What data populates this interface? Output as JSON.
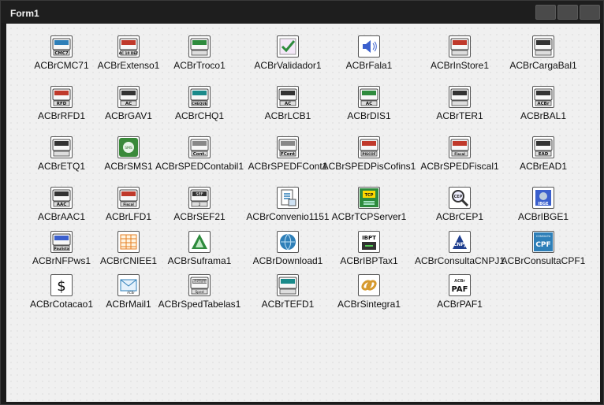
{
  "window": {
    "title": "Form1"
  },
  "titlebar_buttons": [
    "minimize",
    "maximize",
    "close"
  ],
  "components": [
    {
      "label": "ACBrCMC71",
      "icon": "cmc7-check-reader-icon",
      "icon_text": "CMC7",
      "color": "#2e7fb8"
    },
    {
      "label": "ACBrExtenso1",
      "icon": "extenso-number-words-icon",
      "icon_text": "AC 10 DEZ",
      "color": "#c0392b"
    },
    {
      "label": "ACBrTroco1",
      "icon": "troco-change-icon",
      "icon_text": "",
      "color": "#2e8b3d"
    },
    {
      "label": "ACBrValidador1",
      "icon": "validador-check-icon",
      "icon_text": "",
      "color": "#2e8b3d"
    },
    {
      "label": "ACBrFala1",
      "icon": "fala-speaker-icon",
      "icon_text": "",
      "color": "#3a5fcd"
    },
    {
      "label": "ACBrInStore1",
      "icon": "instore-barcode-icon",
      "icon_text": "",
      "color": "#c0392b"
    },
    {
      "label": "ACBrCargaBal1",
      "icon": "carga-bal-scale-load-icon",
      "icon_text": "",
      "color": "#333333"
    },
    {
      "label": "ACBrRFD1",
      "icon": "rfd-printer-icon",
      "icon_text": "RFD",
      "color": "#c0392b"
    },
    {
      "label": "ACBrGAV1",
      "icon": "gav-cash-drawer-icon",
      "icon_text": "AC",
      "color": "#333333"
    },
    {
      "label": "ACBrCHQ1",
      "icon": "chq-cheque-printer-icon",
      "icon_text": "CHEQUE",
      "color": "#1a8a8a"
    },
    {
      "label": "ACBrLCB1",
      "icon": "lcb-barcode-reader-icon",
      "icon_text": "AC",
      "color": "#333333"
    },
    {
      "label": "ACBrDIS1",
      "icon": "dis-display-icon",
      "icon_text": "AC",
      "color": "#2e8b3d"
    },
    {
      "label": "ACBrTER1",
      "icon": "ter-terminal-icon",
      "icon_text": "",
      "color": "#333333"
    },
    {
      "label": "ACBrBAL1",
      "icon": "bal-balance-scale-icon",
      "icon_text": "ACBr",
      "color": "#333333"
    },
    {
      "label": "ACBrETQ1",
      "icon": "etq-label-barcode-icon",
      "icon_text": "",
      "color": "#333333"
    },
    {
      "label": "ACBrSMS1",
      "icon": "sms-phone-icon",
      "icon_text": "SMS",
      "color": "#3a8a3a"
    },
    {
      "label": "ACBrSPEDContabil1",
      "icon": "sped-contabil-icon",
      "icon_text": "Cont.",
      "color": "#888888"
    },
    {
      "label": "ACBrSPEDFCont1",
      "icon": "sped-fcont-icon",
      "icon_text": "FCont",
      "color": "#888888"
    },
    {
      "label": "ACBrSPEDPisCofins1",
      "icon": "sped-piscofins-icon",
      "icon_text": "PISCOF",
      "color": "#c0392b"
    },
    {
      "label": "ACBrSPEDFiscal1",
      "icon": "sped-fiscal-icon",
      "icon_text": "Fiscal",
      "color": "#c0392b"
    },
    {
      "label": "ACBrEAD1",
      "icon": "ead-signature-icon",
      "icon_text": "EAD",
      "color": "#333333"
    },
    {
      "label": "ACBrAAC1",
      "icon": "aac-icon",
      "icon_text": "AAC",
      "color": "#333333"
    },
    {
      "label": "ACBrLFD1",
      "icon": "lfd-fiscal-icon",
      "icon_text": "Fiscal",
      "color": "#c0392b"
    },
    {
      "label": "ACBrSEF21",
      "icon": "sef2-icon",
      "icon_text": "SEF 2",
      "color": "#333333"
    },
    {
      "label": "ACBrConvenio1151",
      "icon": "convenio-document-icon",
      "icon_text": "",
      "color": "#2e7fb8"
    },
    {
      "label": "ACBrTCPServer1",
      "icon": "tcp-server-icon",
      "icon_text": "TCP",
      "color": "#2e8b3d"
    },
    {
      "label": "ACBrCEP1",
      "icon": "cep-magnifier-icon",
      "icon_text": "CEP",
      "color": "#333333"
    },
    {
      "label": "ACBrIBGE1",
      "icon": "ibge-icon",
      "icon_text": "IBGE",
      "color": "#3a5fcd"
    },
    {
      "label": "ACBrNFPws1",
      "icon": "nfp-paulista-icon",
      "icon_text": "Paulista",
      "color": "#3a5fcd"
    },
    {
      "label": "ACBrCNIEE1",
      "icon": "cniee-table-icon",
      "icon_text": "",
      "color": "#e67e22"
    },
    {
      "label": "ACBrSuframa1",
      "icon": "suframa-tree-icon",
      "icon_text": "",
      "color": "#2e8b3d"
    },
    {
      "label": "ACBrDownload1",
      "icon": "download-globe-icon",
      "icon_text": "",
      "color": "#2e7fb8"
    },
    {
      "label": "ACBrIBPTax1",
      "icon": "ibpt-tax-icon",
      "icon_text": "IBPT",
      "color": "#333333"
    },
    {
      "label": "ACBrConsultaCNPJ1",
      "icon": "consulta-cnpj-icon",
      "icon_text": "CNPJ",
      "color": "#1f3f8f"
    },
    {
      "label": "ACBrConsultaCPF1",
      "icon": "consulta-cpf-icon",
      "icon_text": "CPF",
      "color": "#2e7fb8"
    },
    {
      "label": "ACBrCotacao1",
      "icon": "cotacao-dollar-icon",
      "icon_text": "$",
      "color": "#111111"
    },
    {
      "label": "ACBrMail1",
      "icon": "mail-envelope-icon",
      "icon_text": "ACBr",
      "color": "#2e7fb8"
    },
    {
      "label": "ACBrSpedTabelas1",
      "icon": "sped-tabelas-icon",
      "icon_text": "Tabelas Sped",
      "color": "#777777"
    },
    {
      "label": "ACBrTEFD1",
      "icon": "tefd-terminal-icon",
      "icon_text": "",
      "color": "#1a8a8a"
    },
    {
      "label": "ACBrSintegra1",
      "icon": "sintegra-link-icon",
      "icon_text": "",
      "color": "#d69a2e"
    },
    {
      "label": "ACBrPAF1",
      "icon": "paf-icon",
      "icon_text": "PAF",
      "color": "#111111"
    }
  ]
}
